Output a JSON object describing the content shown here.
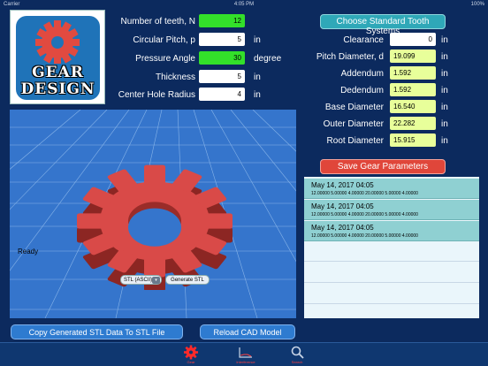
{
  "status_bar": {
    "carrier": "Carrier",
    "time": "4:05 PM",
    "battery": "100%"
  },
  "logo": {
    "line1": "GEAR",
    "line2": "DESIGN"
  },
  "params": [
    {
      "label": "Number of teeth, N",
      "value": "12",
      "unit": ""
    },
    {
      "label": "Circular Pitch, p",
      "value": "5",
      "unit": "in"
    },
    {
      "label": "Pressure Angle",
      "value": "30",
      "unit": "degree"
    },
    {
      "label": "Thickness",
      "value": "5",
      "unit": "in"
    },
    {
      "label": "Center Hole Radius",
      "value": "4",
      "unit": "in"
    }
  ],
  "standard_button": "Choose Standard Tooth Systems",
  "results": [
    {
      "label": "Clearance",
      "value": "0",
      "unit": "in"
    },
    {
      "label": "Pitch Diameter, d",
      "value": "19.099",
      "unit": "in"
    },
    {
      "label": "Addendum",
      "value": "1.592",
      "unit": "in"
    },
    {
      "label": "Dedendum",
      "value": "1.592",
      "unit": "in"
    },
    {
      "label": "Base Diameter",
      "value": "16.540",
      "unit": "in"
    },
    {
      "label": "Outer Diameter",
      "value": "22.282",
      "unit": "in"
    },
    {
      "label": "Root Diameter",
      "value": "15.915",
      "unit": "in"
    }
  ],
  "save_button": "Save Gear Parameters",
  "viewport": {
    "status": "Ready",
    "format_select": "STL (ASCII)",
    "generate_button": "Generate STL"
  },
  "log": [
    {
      "date": "May 14, 2017 04:05",
      "values": "12.00000 5.00000 4.00000 20.00000 5.00000 4.00000"
    },
    {
      "date": "May 14, 2017 04:05",
      "values": "12.00000 5.00000 4.00000 20.00000 5.00000 4.00000"
    },
    {
      "date": "May 14, 2017 04:05",
      "values": "12.00000 5.00000 4.00000 20.00000 5.00000 4.00000"
    }
  ],
  "bottom": {
    "copy_button": "Copy Generated STL Data To STL File",
    "reload_button": "Reload CAD Model"
  },
  "tabs": [
    {
      "label": "Gear",
      "icon": "gear-icon",
      "active": true
    },
    {
      "label": "Interference",
      "icon": "chart-icon",
      "active": false
    },
    {
      "label": "Search",
      "icon": "magnifier-icon",
      "active": false
    }
  ],
  "colors": {
    "accent_green": "#33e02a",
    "result_yellow": "#e8ff9a",
    "save_red": "#e0463a",
    "gear_red": "#d94a48"
  }
}
